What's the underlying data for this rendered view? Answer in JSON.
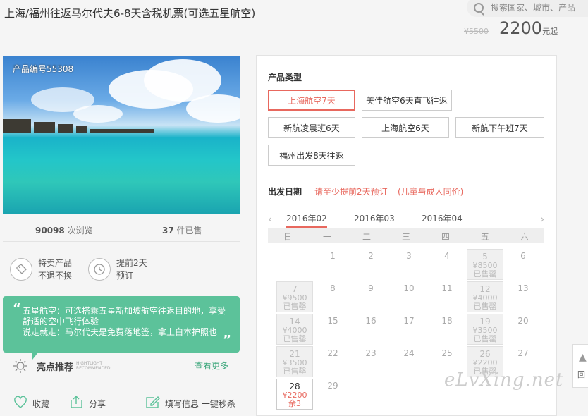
{
  "header": {
    "title": "上海/福州往返马尔代夫6-8天含税机票(可选五星航空)",
    "original_price": "¥5500",
    "price": "2200",
    "price_unit": "元起"
  },
  "search": {
    "placeholder": "搜索国家、城市、产品"
  },
  "product": {
    "number_label": "产品编号55308",
    "views_count": "90098",
    "views_label": "次浏览",
    "sold_count": "37",
    "sold_label": "件已售"
  },
  "features": [
    {
      "icon": "tag-icon",
      "line1": "特卖产品",
      "line2": "不退不换"
    },
    {
      "icon": "clock-icon",
      "line1": "提前2天",
      "line2": "预订"
    }
  ],
  "highlight_text": "五星航空：可选搭乘五星新加坡航空往返目的地，享受舒适的空中飞行体验\n说走就走：马尔代夫是免费落地签，拿上白本护照也",
  "recommend": {
    "title": "亮点推荐",
    "subtitle_en": "HIGHTLIGHT RECOMMENDED",
    "more": "查看更多"
  },
  "actions": [
    "收藏",
    "分享",
    "填写信息 一键秒杀"
  ],
  "booking": {
    "product_type_label": "产品类型",
    "options": [
      "上海航空7天",
      "美佳航空6天直飞往返",
      "新航凌晨班6天",
      "上海航空6天",
      "新航下午班7天",
      "福州出发8天往返"
    ],
    "selected_option": 0,
    "departure_label": "出发日期",
    "advance_note": "请至少提前2天预订",
    "child_note": "(儿童与成人同价)",
    "months": [
      "2016年02",
      "2016年03",
      "2016年04"
    ],
    "selected_month": 0,
    "weekdays": [
      "日",
      "一",
      "二",
      "三",
      "四",
      "五",
      "六"
    ],
    "calendar": [
      [
        {
          "d": ""
        },
        {
          "d": "1"
        },
        {
          "d": "2"
        },
        {
          "d": "3"
        },
        {
          "d": "4"
        },
        {
          "d": "5",
          "price": "¥8500",
          "status": "已售罄"
        },
        {
          "d": "6"
        }
      ],
      [
        {
          "d": "7",
          "price": "¥9500",
          "status": "已售罄"
        },
        {
          "d": "8"
        },
        {
          "d": "9"
        },
        {
          "d": "10"
        },
        {
          "d": "11"
        },
        {
          "d": "12",
          "price": "¥4000",
          "status": "已售罄"
        },
        {
          "d": "13"
        }
      ],
      [
        {
          "d": "14",
          "price": "¥4000",
          "status": "已售罄"
        },
        {
          "d": "15"
        },
        {
          "d": "16"
        },
        {
          "d": "17"
        },
        {
          "d": "18"
        },
        {
          "d": "19",
          "price": "¥3500",
          "status": "已售罄"
        },
        {
          "d": "20"
        }
      ],
      [
        {
          "d": "21",
          "price": "¥3500",
          "status": "已售罄"
        },
        {
          "d": "22"
        },
        {
          "d": "23"
        },
        {
          "d": "24"
        },
        {
          "d": "25"
        },
        {
          "d": "26",
          "price": "¥2200",
          "status": "已售罄"
        },
        {
          "d": "27"
        }
      ],
      [
        {
          "d": "28",
          "price": "¥2200",
          "status": "余3",
          "available": true
        },
        {
          "d": "29"
        }
      ]
    ]
  },
  "watermark": "eLvXing.net",
  "scroll_top_label": "回"
}
